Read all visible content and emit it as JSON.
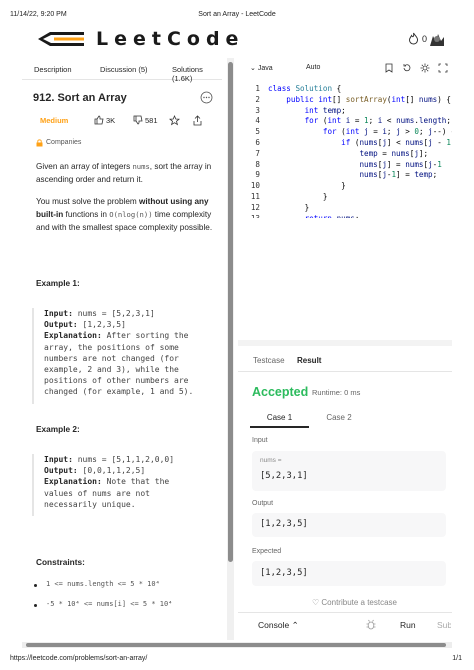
{
  "print": {
    "datetime": "11/14/22, 9:20 PM",
    "title": "Sort an Array - LeetCode",
    "url": "https://leetcode.com/problems/sort-an-array/",
    "page": "1/1"
  },
  "header": {
    "logo_text": "LeetCode",
    "streak_count": "0"
  },
  "left_tabs": [
    "Description",
    "Discussion (5)",
    "Solutions (1.6K)"
  ],
  "problem": {
    "title": "912. Sort an Array",
    "difficulty": "Medium",
    "likes": "3K",
    "dislikes": "581",
    "companies_label": "Companies",
    "desc_p1_a": "Given an array of integers ",
    "desc_p1_code": "nums",
    "desc_p1_b": ", sort the array in ascending order and return it.",
    "desc_p2_a": "You must solve the problem ",
    "desc_p2_bold": "without using any built-in",
    "desc_p2_b": " functions in ",
    "desc_p2_code": "O(nlog(n))",
    "desc_p2_c": " time complexity and with the smallest space complexity possible.",
    "example1": {
      "heading": "Example 1:",
      "input_label": "Input:",
      "input": " nums = [5,2,3,1]",
      "output_label": "Output:",
      "output": " [1,2,3,5]",
      "explanation_label": "Explanation:",
      "explanation_lines": [
        " After sorting the",
        "array, the positions of some",
        "numbers are not changed (for",
        "example, 2 and 3), while the",
        "positions of other numbers are",
        "changed (for example, 1 and 5)."
      ]
    },
    "example2": {
      "heading": "Example 2:",
      "input_label": "Input:",
      "input": " nums = [5,1,1,2,0,0]",
      "output_label": "Output:",
      "output": " [0,0,1,1,2,5]",
      "explanation_label": "Explanation:",
      "explanation_lines": [
        " Note that the",
        "values of nums are not",
        "necessarily unique."
      ]
    },
    "constraints_heading": "Constraints:",
    "constraints": [
      "1 <= nums.length <= 5 * 10⁴",
      "-5 * 10⁴ <= nums[i] <= 5 * 10⁴"
    ]
  },
  "editor": {
    "language": "Java",
    "mode": "Auto",
    "line_numbers": [
      "1",
      "2",
      "3",
      "4",
      "5",
      "6",
      "7",
      "8",
      "9",
      "10",
      "11",
      "12",
      "13"
    ]
  },
  "results": {
    "tab_testcase": "Testcase",
    "tab_result": "Result",
    "status": "Accepted",
    "runtime": "Runtime: 0 ms",
    "case1": "Case 1",
    "case2": "Case 2",
    "input_label": "Input",
    "input_var": "nums =",
    "input_value": "[5,2,3,1]",
    "output_label": "Output",
    "output_value": "[1,2,3,5]",
    "expected_label": "Expected",
    "expected_value": "[1,2,3,5]",
    "contribute": "Contribute a testcase"
  },
  "bottom": {
    "console": "Console",
    "run": "Run",
    "submit": "Submit"
  },
  "colors": {
    "accepted": "#2cbb5d",
    "medium": "#ffa116",
    "keyword": "#0000ff"
  }
}
